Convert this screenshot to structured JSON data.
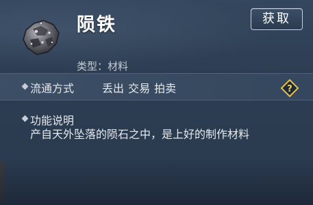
{
  "item": {
    "name": "陨铁",
    "type_line": "类型：材料",
    "icon": "meteorite-ore-icon"
  },
  "buttons": {
    "acquire_label": "获取"
  },
  "circulation": {
    "label": "流通方式",
    "methods": "丢出 交易 拍卖",
    "help_icon": "help-diamond-icon"
  },
  "function": {
    "label": "功能说明",
    "description": "产自天外坠落的陨石之中，是上好的制作材料"
  },
  "colors": {
    "panel_bg": "#2c3d52",
    "help_icon_accent": "#e8c24a",
    "text": "#e6e9ee"
  }
}
